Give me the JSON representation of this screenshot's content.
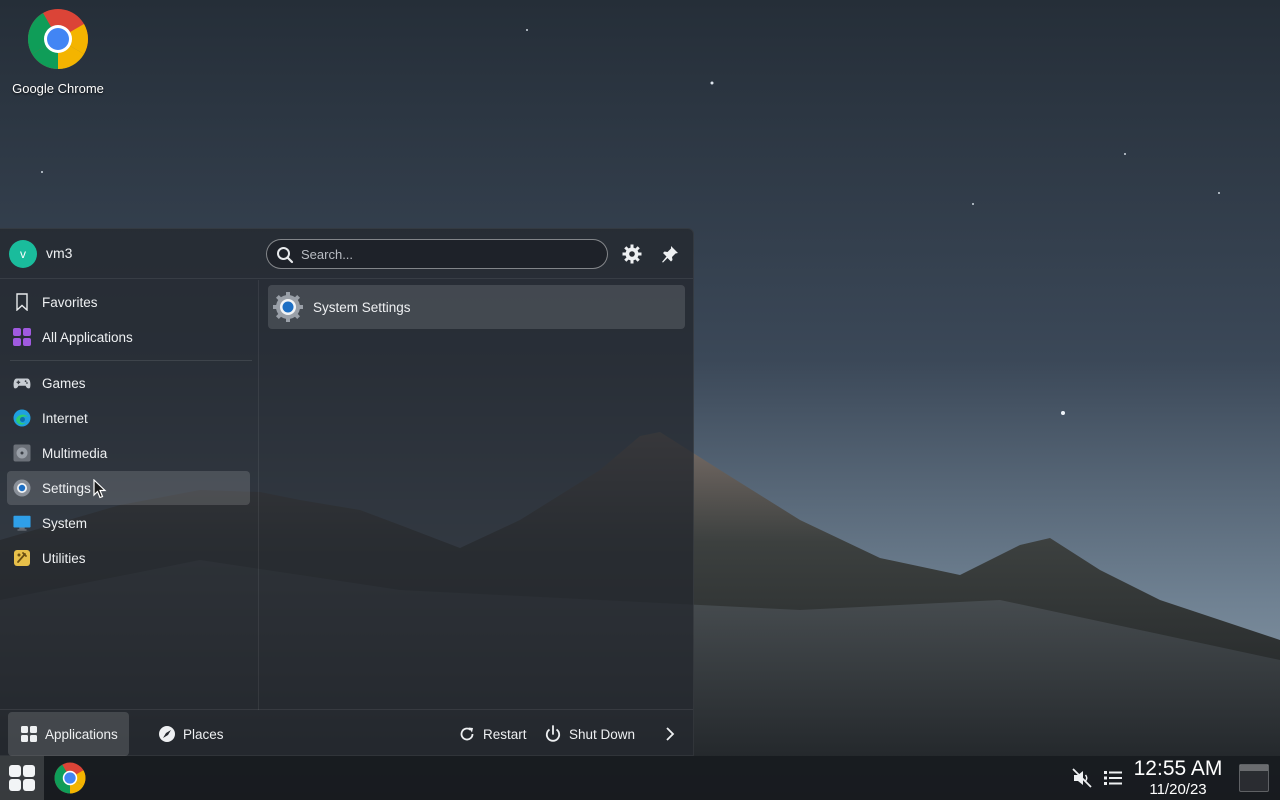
{
  "desktop": {
    "icons": [
      {
        "label": "Google Chrome",
        "icon": "chrome-icon"
      }
    ]
  },
  "launcher": {
    "user": {
      "initial": "v",
      "name": "vm3"
    },
    "search": {
      "placeholder": "Search...",
      "value": ""
    },
    "header_buttons": [
      {
        "name": "configure",
        "icon": "gear-icon"
      },
      {
        "name": "pin",
        "icon": "pin-icon"
      }
    ],
    "categories": [
      {
        "label": "Favorites",
        "icon": "bookmark-icon"
      },
      {
        "label": "All Applications",
        "icon": "grid-icon"
      },
      {
        "label": "Games",
        "icon": "gamepad-icon"
      },
      {
        "label": "Internet",
        "icon": "globe-icon"
      },
      {
        "label": "Multimedia",
        "icon": "media-icon"
      },
      {
        "label": "Settings",
        "icon": "settings-icon",
        "active": true
      },
      {
        "label": "System",
        "icon": "monitor-icon"
      },
      {
        "label": "Utilities",
        "icon": "tools-icon"
      }
    ],
    "results": [
      {
        "label": "System Settings",
        "icon": "system-settings-icon"
      }
    ],
    "footer": {
      "applications": "Applications",
      "places": "Places",
      "restart": "Restart",
      "shutdown": "Shut Down"
    }
  },
  "taskbar": {
    "tray": {
      "volume": "muted-volume-icon",
      "notifications": "list-icon"
    },
    "clock": {
      "time": "12:55 AM",
      "date": "11/20/23"
    }
  },
  "colors": {
    "accent": "#1abc9c",
    "panel": "#24282e",
    "taskbar": "#181b1f"
  }
}
